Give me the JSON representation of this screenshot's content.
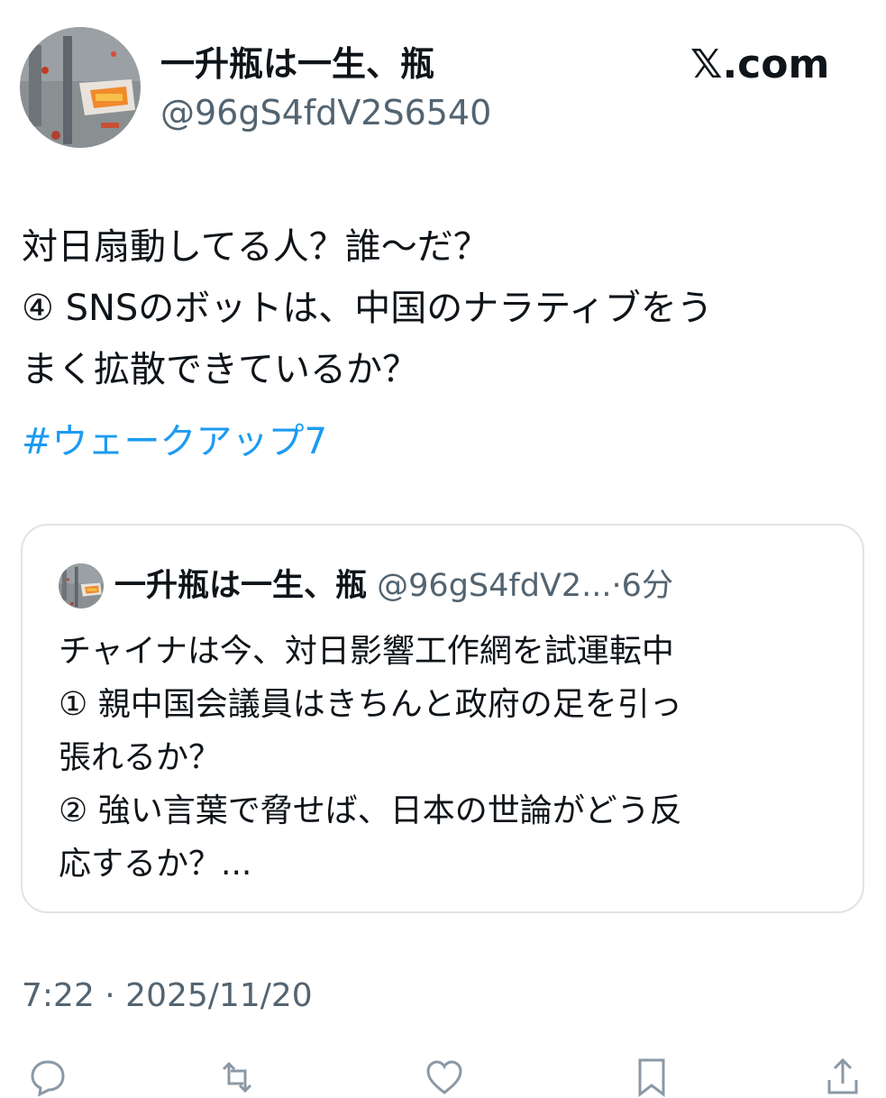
{
  "header": {
    "author_name": "一升瓶は一生、瓶",
    "author_handle": "@96gS4fdV2S6540",
    "brand": "𝕏.com"
  },
  "tweet": {
    "lines": [
      "対日扇動してる人？誰〜だ？",
      "④ SNSのボットは、中国のナラティブをう",
      "まく拡散できているか？"
    ],
    "hashtag": "#ウェークアップ7"
  },
  "quote": {
    "author_name": "一升瓶は一生、瓶",
    "author_handle": "@96gS4fdV2...",
    "separator": "·",
    "time": "6分",
    "lines": [
      "チャイナは今、対日影響工作網を試運転中",
      "① 親中国会議員はきちんと政府の足を引っ",
      "張れるか？",
      "② 強い言葉で脅せば、日本の世論がどう反",
      "応するか？..."
    ]
  },
  "timestamp": "7:22 · 2025/11/20",
  "actions": {
    "icons": [
      "reply-icon",
      "retweet-icon",
      "like-icon",
      "bookmark-icon",
      "share-icon"
    ]
  },
  "colors": {
    "text": "#0f1419",
    "secondary": "#536471",
    "link": "#1d9bf0",
    "border": "#dfe3e8"
  }
}
